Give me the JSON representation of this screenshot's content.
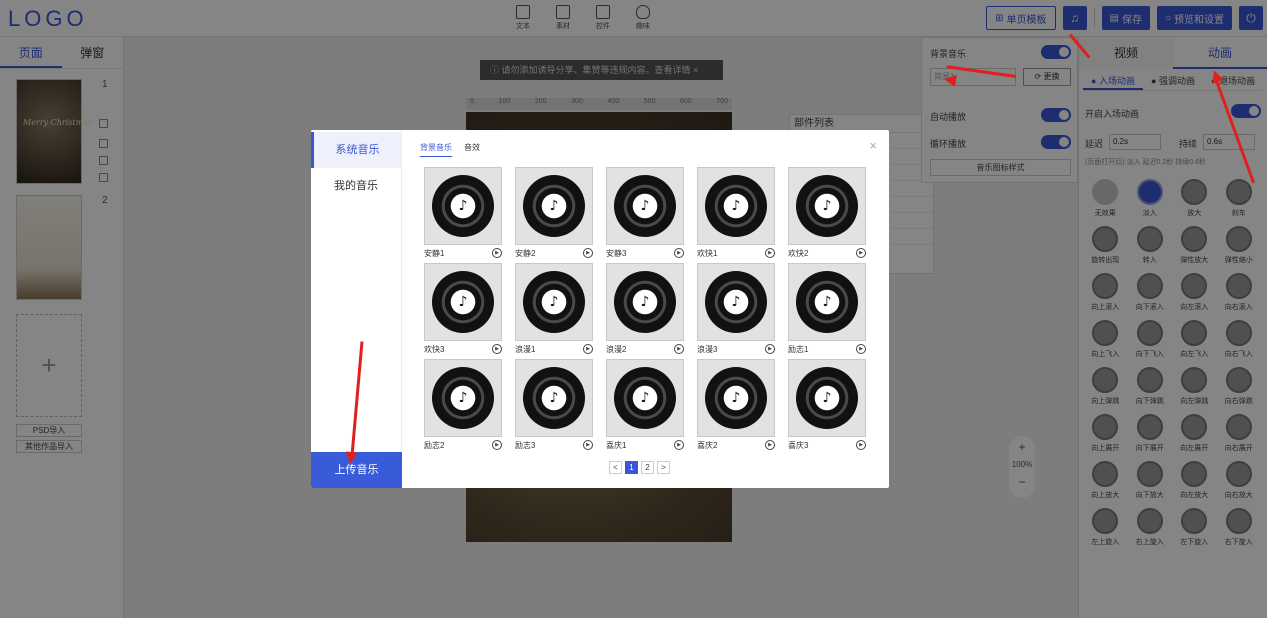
{
  "logo": "LOGO",
  "toolbar": {
    "tools": [
      {
        "label": "文本",
        "icon": "text-icon"
      },
      {
        "label": "素材",
        "icon": "image-icon"
      },
      {
        "label": "控件",
        "icon": "widget-icon"
      },
      {
        "label": "趣味",
        "icon": "bulb-icon"
      }
    ],
    "single_template": "单页模板",
    "music_icon": "♫",
    "save": "保存",
    "preview": "预览和设置",
    "power_icon": "⏻"
  },
  "left_panel": {
    "tabs": [
      "页面",
      "弹窗"
    ],
    "page_numbers": [
      "1",
      "2"
    ],
    "thumb_text": "Merry Christmas",
    "add_icon": "+",
    "psd_import": "PSD导入",
    "other_import": "其他作品导入"
  },
  "canvas": {
    "notice": "请勿添加诱导分享、集赞等违规内容。查看详情",
    "ruler_ticks": [
      "0",
      "100",
      "200",
      "300",
      "400",
      "500",
      "600",
      "700"
    ],
    "component_list_title": "部件列表",
    "zoom_in": "+",
    "zoom_value": "100%",
    "zoom_out": "−"
  },
  "music_panel": {
    "bg_music": "背景音乐",
    "input_placeholder": "简易1",
    "replace_btn": "更换",
    "auto_play": "自动播放",
    "loop_play": "循环播放",
    "icon_style": "音乐图标样式"
  },
  "right_panel": {
    "tabs": [
      "视频",
      "动画"
    ],
    "subtabs": [
      "● 入场动画",
      "● 强调动画",
      "● 退场动画"
    ],
    "enable_entrance": "开启入场动画",
    "delay_label": "延迟",
    "delay_value": "0.2s",
    "duration_label": "持续",
    "duration_value": "0.6s",
    "hint": "(页面打开后) 淡入 延迟0.2秒 持续0.6秒",
    "animations": [
      "无效果",
      "淡入",
      "放大",
      "刹车",
      "旋转出现",
      "转入",
      "弹性放大",
      "弹性缩小",
      "向上滚入",
      "向下滚入",
      "向左滚入",
      "向右滚入",
      "向上飞入",
      "向下飞入",
      "向左飞入",
      "向右飞入",
      "向上弹跳",
      "向下弹跳",
      "向左弹跳",
      "向右弹跳",
      "向上展开",
      "向下展开",
      "向左展开",
      "向右展开",
      "向上放大",
      "向下放大",
      "向左放大",
      "向右放大",
      "左上旋入",
      "右上旋入",
      "左下旋入",
      "右下旋入"
    ]
  },
  "modal": {
    "sidebar": [
      "系统音乐",
      "我的音乐"
    ],
    "upload": "上传音乐",
    "tabs": [
      "背景音乐",
      "音效"
    ],
    "close_icon": "×",
    "note_glyph": "♪",
    "play_glyph": "▶",
    "tracks": [
      "安静1",
      "安静2",
      "安静3",
      "欢快1",
      "欢快2",
      "欢快3",
      "浪漫1",
      "浪漫2",
      "浪漫3",
      "励志1",
      "励志2",
      "励志3",
      "喜庆1",
      "喜庆2",
      "喜庆3"
    ],
    "pager": {
      "prev": "<",
      "pages": [
        "1",
        "2"
      ],
      "next": ">"
    }
  },
  "colors": {
    "accent": "#3a56d6",
    "annotation_arrow": "#e0201c"
  }
}
